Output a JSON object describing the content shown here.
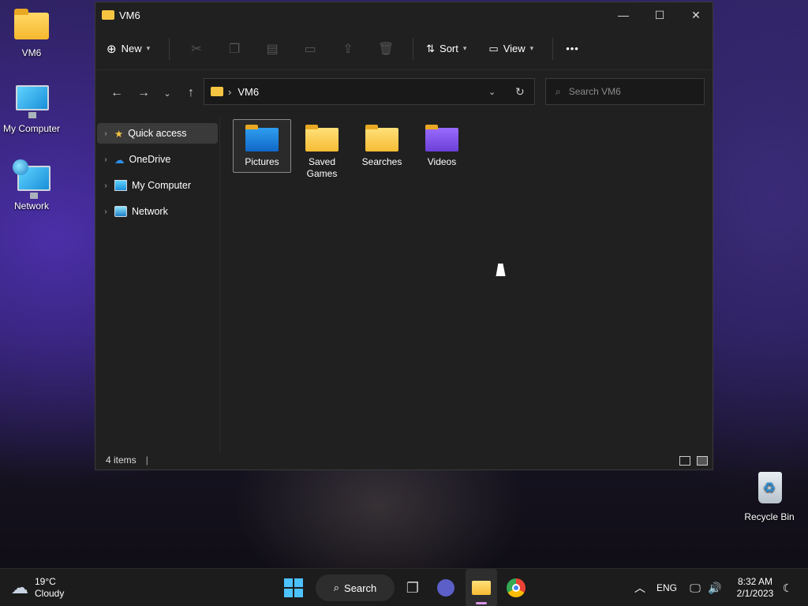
{
  "desktop": {
    "icons": [
      {
        "label": "VM6"
      },
      {
        "label": "My Computer"
      },
      {
        "label": "Network"
      },
      {
        "label": "Recycle Bin"
      }
    ]
  },
  "window": {
    "title": "VM6",
    "controls": {
      "minimize": "—",
      "maximize": "☐",
      "close": "✕"
    }
  },
  "toolbar": {
    "new_label": "New",
    "sort_label": "Sort",
    "view_label": "View",
    "more_label": "•••"
  },
  "address": {
    "path": "VM6",
    "search_placeholder": "Search VM6"
  },
  "sidebar": {
    "items": [
      {
        "label": "Quick access"
      },
      {
        "label": "OneDrive"
      },
      {
        "label": "My Computer"
      },
      {
        "label": "Network"
      }
    ]
  },
  "files": [
    {
      "label": "Pictures"
    },
    {
      "label": "Saved\nGames"
    },
    {
      "label": "Searches"
    },
    {
      "label": "Videos"
    }
  ],
  "status": {
    "count": "4 items"
  },
  "taskbar": {
    "weather_temp": "19°C",
    "weather_desc": "Cloudy",
    "search_label": "Search",
    "lang": "ENG",
    "time": "8:32 AM",
    "date": "2/1/2023"
  }
}
